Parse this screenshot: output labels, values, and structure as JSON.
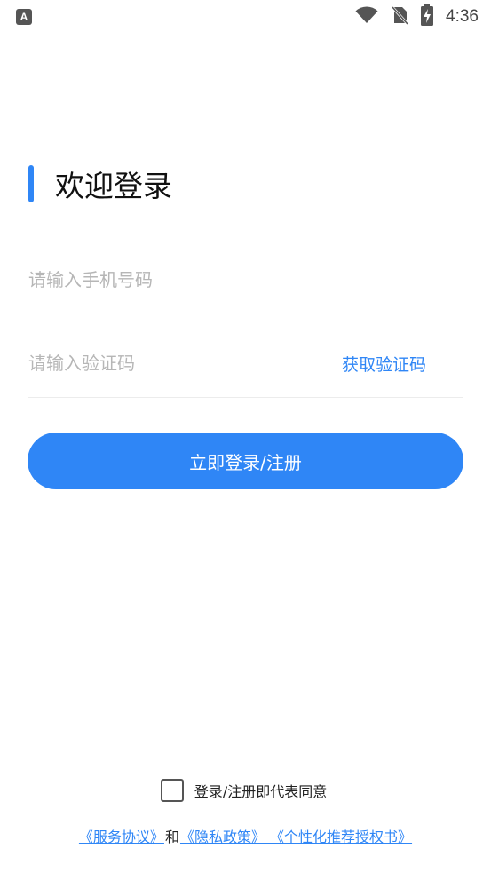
{
  "status_bar": {
    "app_icon_letter": "A",
    "time": "4:36",
    "icons": [
      "wifi-icon",
      "no-sim-icon",
      "battery-charging-icon"
    ]
  },
  "login": {
    "title": "欢迎登录",
    "phone_placeholder": "请输入手机号码",
    "code_placeholder": "请输入验证码",
    "get_code_label": "获取验证码",
    "submit_label": "立即登录/注册"
  },
  "agreement": {
    "checked": false,
    "text": "登录/注册即代表同意",
    "service_link": "《服务协议》",
    "and": "和",
    "privacy_link": "《隐私政策》",
    "personalized_link": " 《个性化推荐授权书》"
  },
  "colors": {
    "accent": "#2f86f6",
    "placeholder": "#b6b6b6"
  }
}
